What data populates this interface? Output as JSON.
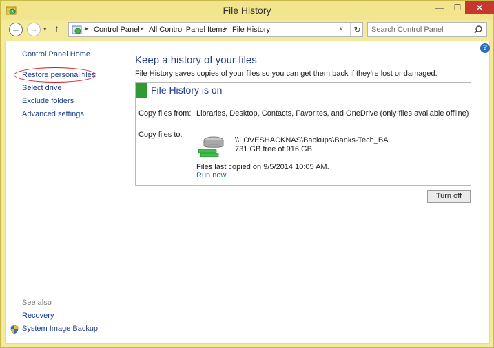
{
  "window": {
    "title": "File History",
    "controls": {
      "minimize": "—",
      "maximize": "☐",
      "close": "✕"
    }
  },
  "nav": {
    "back": "←",
    "forward": "→",
    "recent": "▾",
    "up": "↑",
    "breadcrumbs": [
      "Control Panel",
      "All Control Panel Items",
      "File History"
    ],
    "separator": "▸",
    "dropdown": "∨",
    "refresh": "↻",
    "search_placeholder": "Search Control Panel"
  },
  "help": "?",
  "sidebar": {
    "home": "Control Panel Home",
    "links": [
      "Restore personal files",
      "Select drive",
      "Exclude folders",
      "Advanced settings"
    ],
    "see_also": {
      "label": "See also",
      "links": [
        "Recovery",
        "System Image Backup"
      ]
    }
  },
  "main": {
    "title": "Keep a history of your files",
    "description": "File History saves copies of your files so you can get them back if they're lost or damaged.",
    "status": "File History is on",
    "copy_from_label": "Copy files from:",
    "copy_from_value": "Libraries, Desktop, Contacts, Favorites, and OneDrive (only files available offline)",
    "copy_to_label": "Copy files to:",
    "drive_path": "\\\\LOVESHACKNAS\\Backups\\Banks-Tech_BA",
    "drive_space": "731 GB free of 916 GB",
    "last_copied": "Files last copied on 9/5/2014 10:05 AM.",
    "run_now": "Run now",
    "turn_off": "Turn off"
  },
  "colors": {
    "frame": "#f4ea9c",
    "link": "#1c3d8e",
    "heading": "#1f3c8c",
    "status_green": "#2f9a33",
    "highlight_ellipse": "#d2161e",
    "close_button": "#c7372f"
  }
}
